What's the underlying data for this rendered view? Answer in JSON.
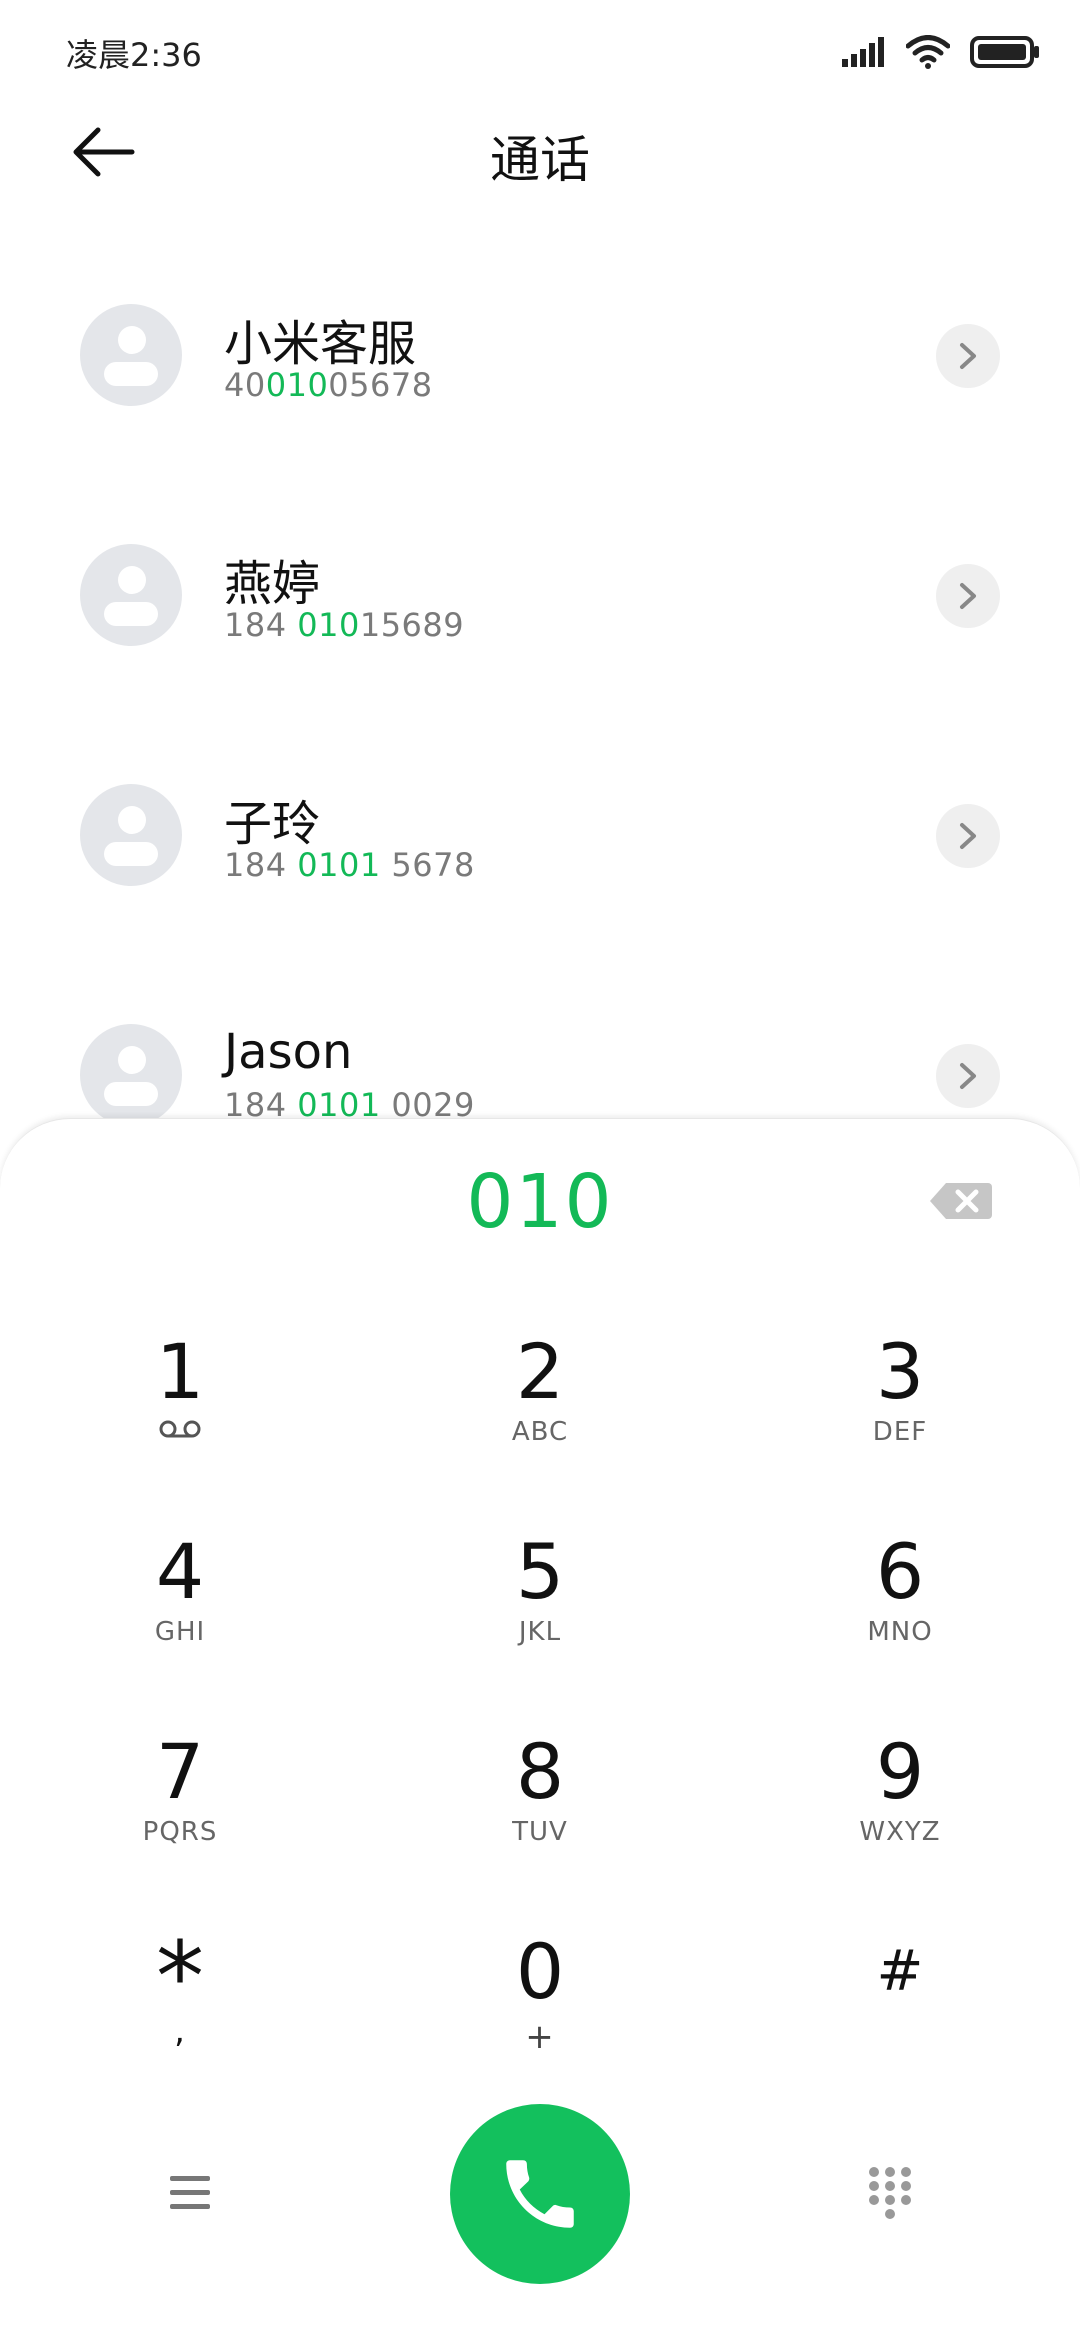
{
  "status_bar": {
    "time": "凌晨2:36",
    "icons": [
      "signal-icon",
      "wifi-icon",
      "battery-icon"
    ]
  },
  "header": {
    "title": "通话",
    "back_icon": "arrow-left-icon"
  },
  "contacts": [
    {
      "name": "小米客服",
      "number_parts": [
        "40",
        "010",
        "05678"
      ]
    },
    {
      "name": "燕婷",
      "number_parts": [
        "184 ",
        "010",
        "15689"
      ]
    },
    {
      "name": "子玲",
      "number_parts": [
        "184 ",
        "0101",
        " 5678"
      ]
    },
    {
      "name": "Jason",
      "number_parts": [
        "184 ",
        "0101",
        " 0029"
      ]
    }
  ],
  "dialer": {
    "input": "010",
    "keys": [
      {
        "digit": "1",
        "letters": "ᴑᴑ"
      },
      {
        "digit": "2",
        "letters": "ABC"
      },
      {
        "digit": "3",
        "letters": "DEF"
      },
      {
        "digit": "4",
        "letters": "GHI"
      },
      {
        "digit": "5",
        "letters": "JKL"
      },
      {
        "digit": "6",
        "letters": "MNO"
      },
      {
        "digit": "7",
        "letters": "PQRS"
      },
      {
        "digit": "8",
        "letters": "TUV"
      },
      {
        "digit": "9",
        "letters": "WXYZ"
      },
      {
        "digit": "*",
        "letters": ","
      },
      {
        "digit": "0",
        "letters": "+"
      },
      {
        "digit": "#",
        "letters": ""
      }
    ]
  },
  "colors": {
    "accent_green": "#13b957",
    "call_button": "#13c05d"
  }
}
